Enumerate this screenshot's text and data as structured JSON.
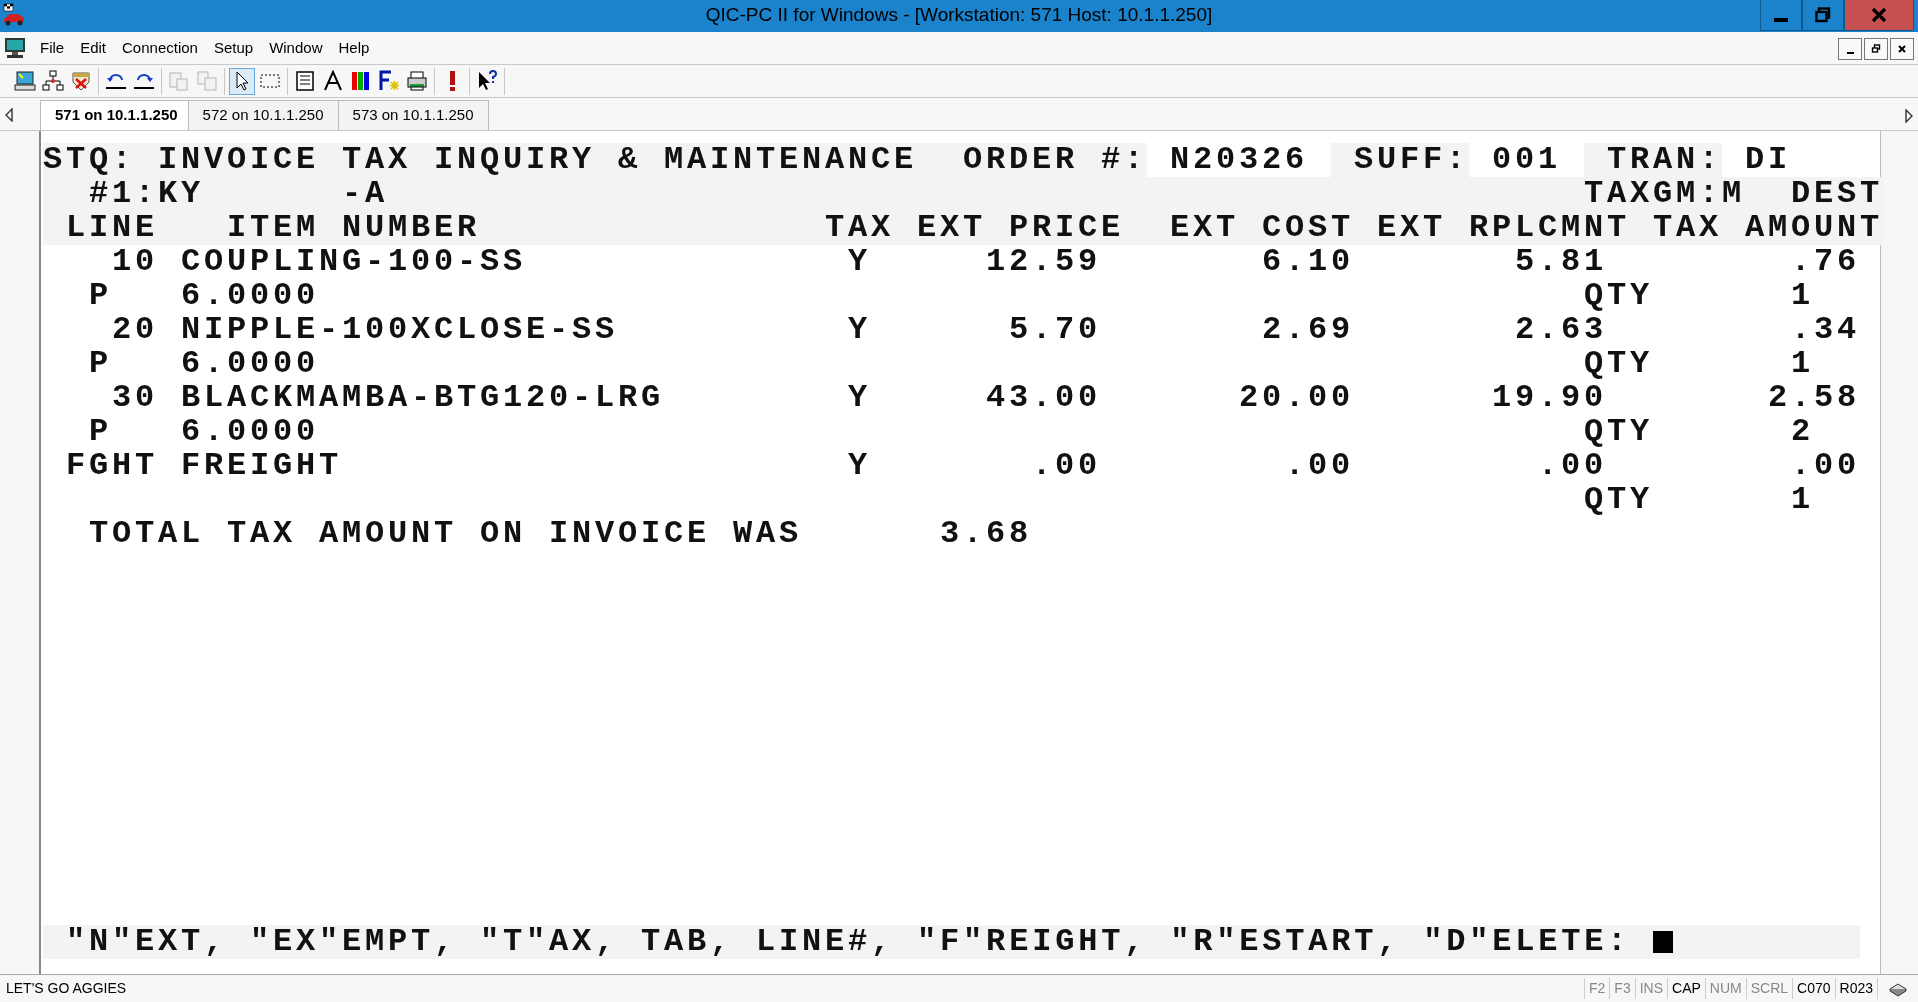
{
  "window": {
    "title": "QIC-PC II for Windows - [Workstation: 571  Host: 10.1.1.250]"
  },
  "menu": [
    "File",
    "Edit",
    "Connection",
    "Setup",
    "Window",
    "Help"
  ],
  "toolbar": {
    "groups": [
      [
        {
          "disabled": false,
          "selected": false
        },
        {
          "disabled": false,
          "selected": false
        },
        {
          "disabled": false,
          "selected": false
        }
      ],
      [
        {
          "disabled": false,
          "selected": false
        },
        {
          "disabled": false,
          "selected": false
        }
      ],
      [
        {
          "disabled": true,
          "selected": false
        },
        {
          "disabled": true,
          "selected": false
        }
      ],
      [
        {
          "disabled": false,
          "selected": true
        },
        {
          "disabled": false,
          "selected": false
        }
      ],
      [
        {
          "disabled": false,
          "selected": false
        },
        {
          "disabled": false,
          "selected": false
        },
        {
          "disabled": false,
          "selected": false
        },
        {
          "disabled": false,
          "selected": false
        },
        {
          "disabled": false,
          "selected": false
        }
      ],
      [
        {
          "disabled": false,
          "selected": false
        }
      ],
      [
        {
          "disabled": false,
          "selected": false
        }
      ]
    ]
  },
  "tabs": [
    {
      "label": "571 on 10.1.1.250",
      "selected": true
    },
    {
      "label": "572 on 10.1.1.250",
      "selected": false
    },
    {
      "label": "573 on 10.1.1.250",
      "selected": false
    }
  ],
  "terminal": {
    "title_line": {
      "program": "STQ:",
      "title": "INVOICE TAX INQUIRY & MAINTENANCE",
      "fields": [
        {
          "label": "ORDER #:",
          "value": "N20326"
        },
        {
          "label": "SUFF:",
          "value": "001"
        },
        {
          "label": "TRAN:",
          "value": "DI"
        }
      ]
    },
    "second_line": {
      "state": "#1:KY",
      "suffix": "-A",
      "taxgm": "TAXGM:M",
      "dest": "DEST"
    },
    "columns": [
      "LINE",
      "ITEM NUMBER",
      "TAX",
      "EXT PRICE",
      "EXT COST",
      "EXT RPLCMNT",
      "TAX AMOUNT"
    ],
    "rows": [
      {
        "line": "10",
        "item": "COUPLING-100-SS",
        "tax": "Y",
        "ext_price": "12.59",
        "ext_cost": "6.10",
        "ext_rplcmnt": "5.81",
        "tax_amount": ".76",
        "detail": {
          "type": "P",
          "value": "6.0000",
          "qty_label": "QTY",
          "qty": "1"
        }
      },
      {
        "line": "20",
        "item": "NIPPLE-100XCLOSE-SS",
        "tax": "Y",
        "ext_price": "5.70",
        "ext_cost": "2.69",
        "ext_rplcmnt": "2.63",
        "tax_amount": ".34",
        "detail": {
          "type": "P",
          "value": "6.0000",
          "qty_label": "QTY",
          "qty": "1"
        }
      },
      {
        "line": "30",
        "item": "BLACKMAMBA-BTG120-LRG",
        "tax": "Y",
        "ext_price": "43.00",
        "ext_cost": "20.00",
        "ext_rplcmnt": "19.90",
        "tax_amount": "2.58",
        "detail": {
          "type": "P",
          "value": "6.0000",
          "qty_label": "QTY",
          "qty": "2"
        }
      },
      {
        "line": "FGHT",
        "item": "FREIGHT",
        "tax": "Y",
        "ext_price": ".00",
        "ext_cost": ".00",
        "ext_rplcmnt": ".00",
        "tax_amount": ".00",
        "detail": {
          "qty_label": "QTY",
          "qty": "1"
        }
      }
    ],
    "total": {
      "label": "TOTAL TAX AMOUNT ON INVOICE WAS",
      "value": "3.68"
    },
    "prompt": "\"N\"EXT, \"EX\"EMPT, \"T\"AX, TAB, LINE#, \"F\"REIGHT, \"R\"ESTART, \"D\"ELETE:"
  },
  "status_bar": {
    "message": "LET'S GO AGGIES",
    "indicators": [
      {
        "label": "F2",
        "on": false
      },
      {
        "label": "F3",
        "on": false
      },
      {
        "label": "INS",
        "on": false
      },
      {
        "label": "CAP",
        "on": true
      },
      {
        "label": "NUM",
        "on": false
      },
      {
        "label": "SCRL",
        "on": false
      }
    ],
    "column": "C070",
    "row": "R023"
  }
}
